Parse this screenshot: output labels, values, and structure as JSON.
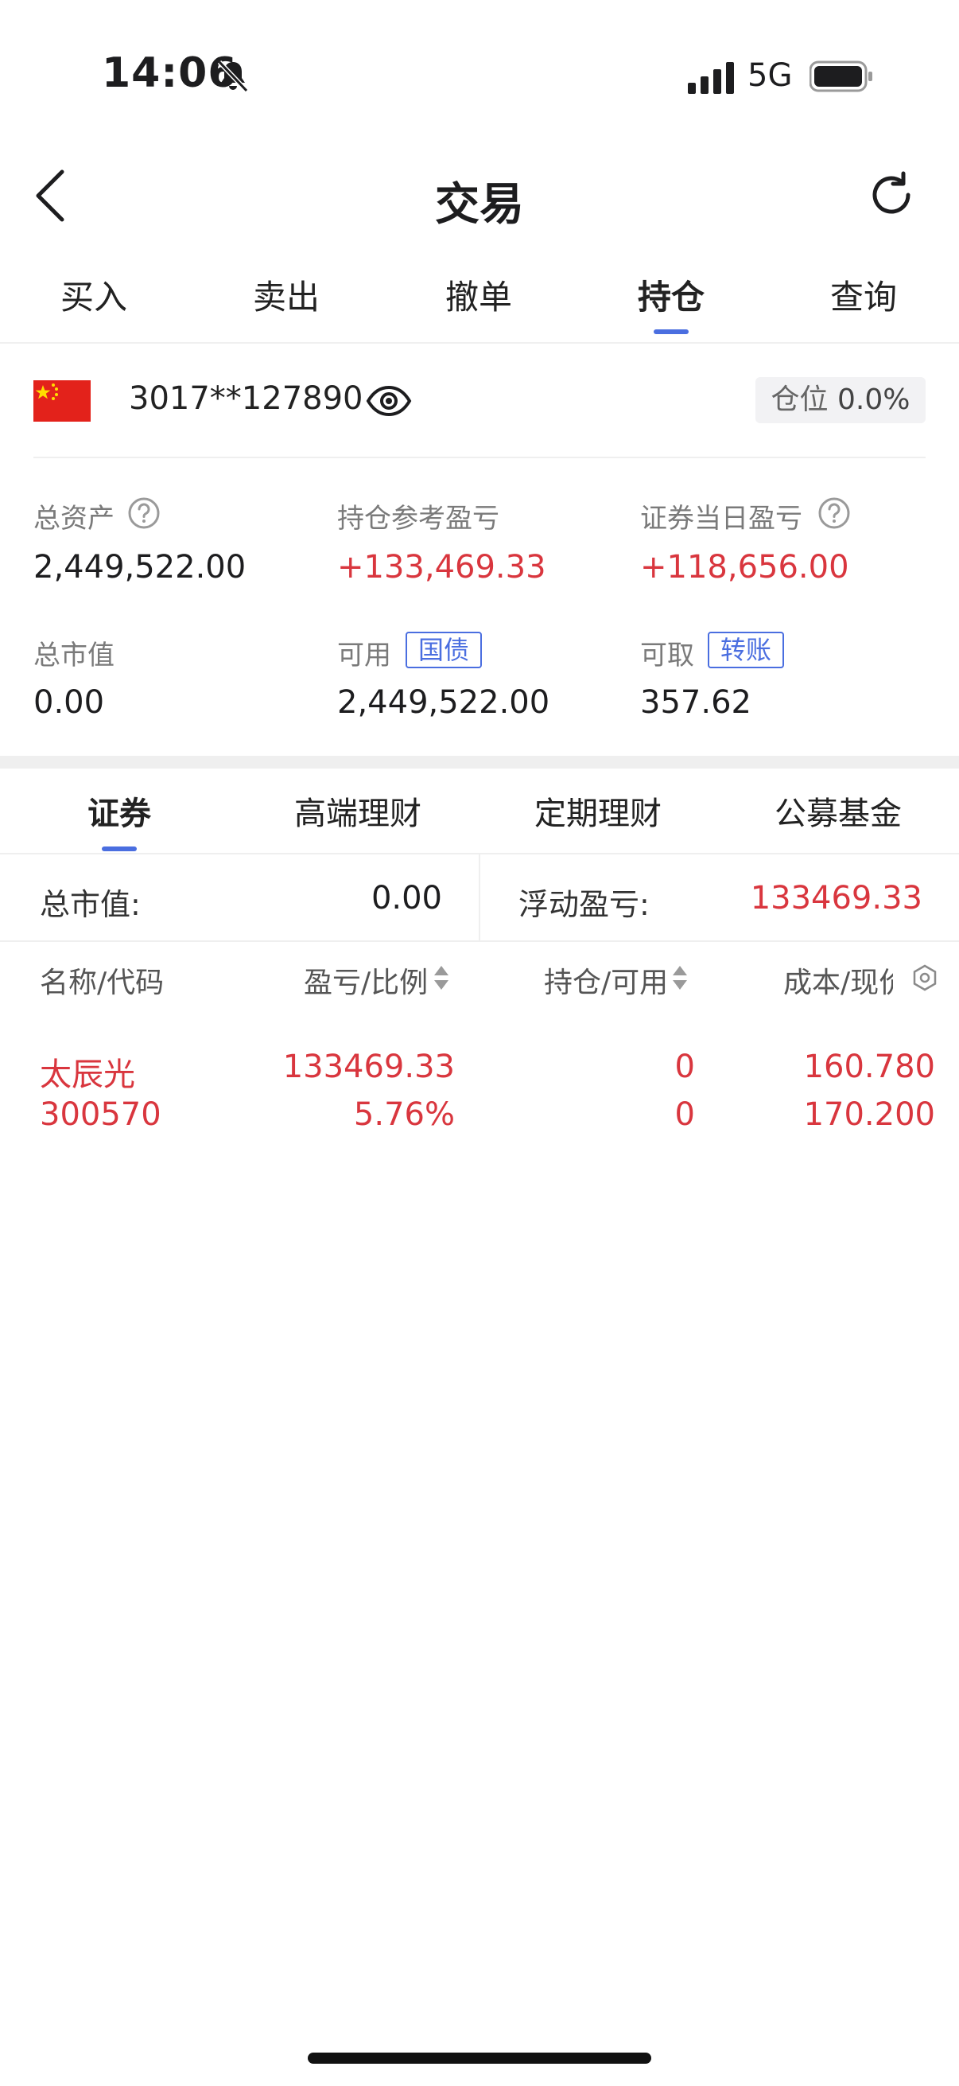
{
  "status_bar": {
    "time": "14:06",
    "network": "5G",
    "icons": [
      "bell-slash-icon",
      "signal-icon",
      "battery-icon"
    ]
  },
  "nav": {
    "title": "交易",
    "back_icon": "chevron-left-icon",
    "refresh_icon": "refresh-icon"
  },
  "tabs": [
    {
      "label": "买入",
      "active": false
    },
    {
      "label": "卖出",
      "active": false
    },
    {
      "label": "撤单",
      "active": false
    },
    {
      "label": "持仓",
      "active": true
    },
    {
      "label": "查询",
      "active": false
    }
  ],
  "account": {
    "id": "3017**127890",
    "position_label": "仓位",
    "position_value": "0.0%"
  },
  "stats": {
    "total_assets": {
      "label": "总资产",
      "value": "2,449,522.00"
    },
    "holding_pnl": {
      "label": "持仓参考盈亏",
      "value": "+133,469.33"
    },
    "today_pnl": {
      "label": "证券当日盈亏",
      "value": "+118,656.00"
    },
    "market_value": {
      "label": "总市值",
      "value": "0.00"
    },
    "available": {
      "label": "可用",
      "badge": "国债",
      "value": "2,449,522.00"
    },
    "withdrawable": {
      "label": "可取",
      "badge": "转账",
      "value": "357.62"
    }
  },
  "sub_tabs": [
    {
      "label": "证券",
      "active": true
    },
    {
      "label": "高端理财",
      "active": false
    },
    {
      "label": "定期理财",
      "active": false
    },
    {
      "label": "公募基金",
      "active": false
    }
  ],
  "summary": {
    "market_value_label": "总市值:",
    "market_value": "0.00",
    "floating_pnl_label": "浮动盈亏:",
    "floating_pnl": "133469.33"
  },
  "table": {
    "headers": [
      "名称/代码",
      "盈亏/比例",
      "持仓/可用",
      "成本/现价"
    ],
    "rows": [
      {
        "name": "太辰光",
        "code": "300570",
        "pnl": "133469.33",
        "ratio": "5.76%",
        "holding": "0",
        "available": "0",
        "cost": "160.780",
        "price": "170.200"
      }
    ]
  },
  "colors": {
    "accent": "#4a6ee0",
    "gain": "#d9363e"
  }
}
